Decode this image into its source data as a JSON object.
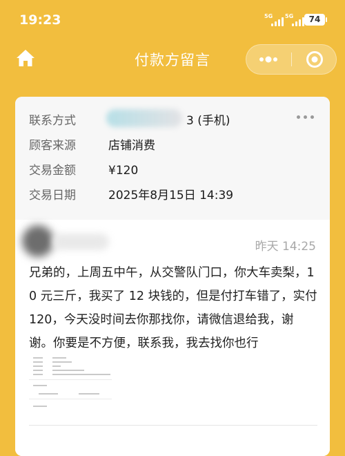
{
  "status_bar": {
    "time": "19:23",
    "signal_1_label": "5G",
    "signal_2_label": "5G",
    "battery": "74"
  },
  "navbar": {
    "title": "付款方留言",
    "home_icon": "home-icon",
    "more_icon": "more-dots-icon",
    "close_icon": "close-circle-icon"
  },
  "payer_info": {
    "contact_label": "联系方式",
    "contact_value_visible": "3 (手机)",
    "source_label": "顾客来源",
    "source_value": "店铺消费",
    "amount_label": "交易金额",
    "amount_value": "¥120",
    "date_label": "交易日期",
    "date_value": "2025年8月15日 14:39"
  },
  "message": {
    "time": "昨天 14:25",
    "text": "兄弟的，上周五中午，从交警队门口，你大车卖梨，10 元三斤，我买了 12 块钱的，但是付打车错了，实付 120，今天没时间去你那找你，请微信退给我，谢谢。你要是不方便，联系我，我去找你也行"
  },
  "colors": {
    "background": "#F2BE3E",
    "card": "#FFFFFF",
    "info_panel": "#F7F7F7",
    "label_text": "#666666",
    "time_text": "#A8A8A8"
  }
}
